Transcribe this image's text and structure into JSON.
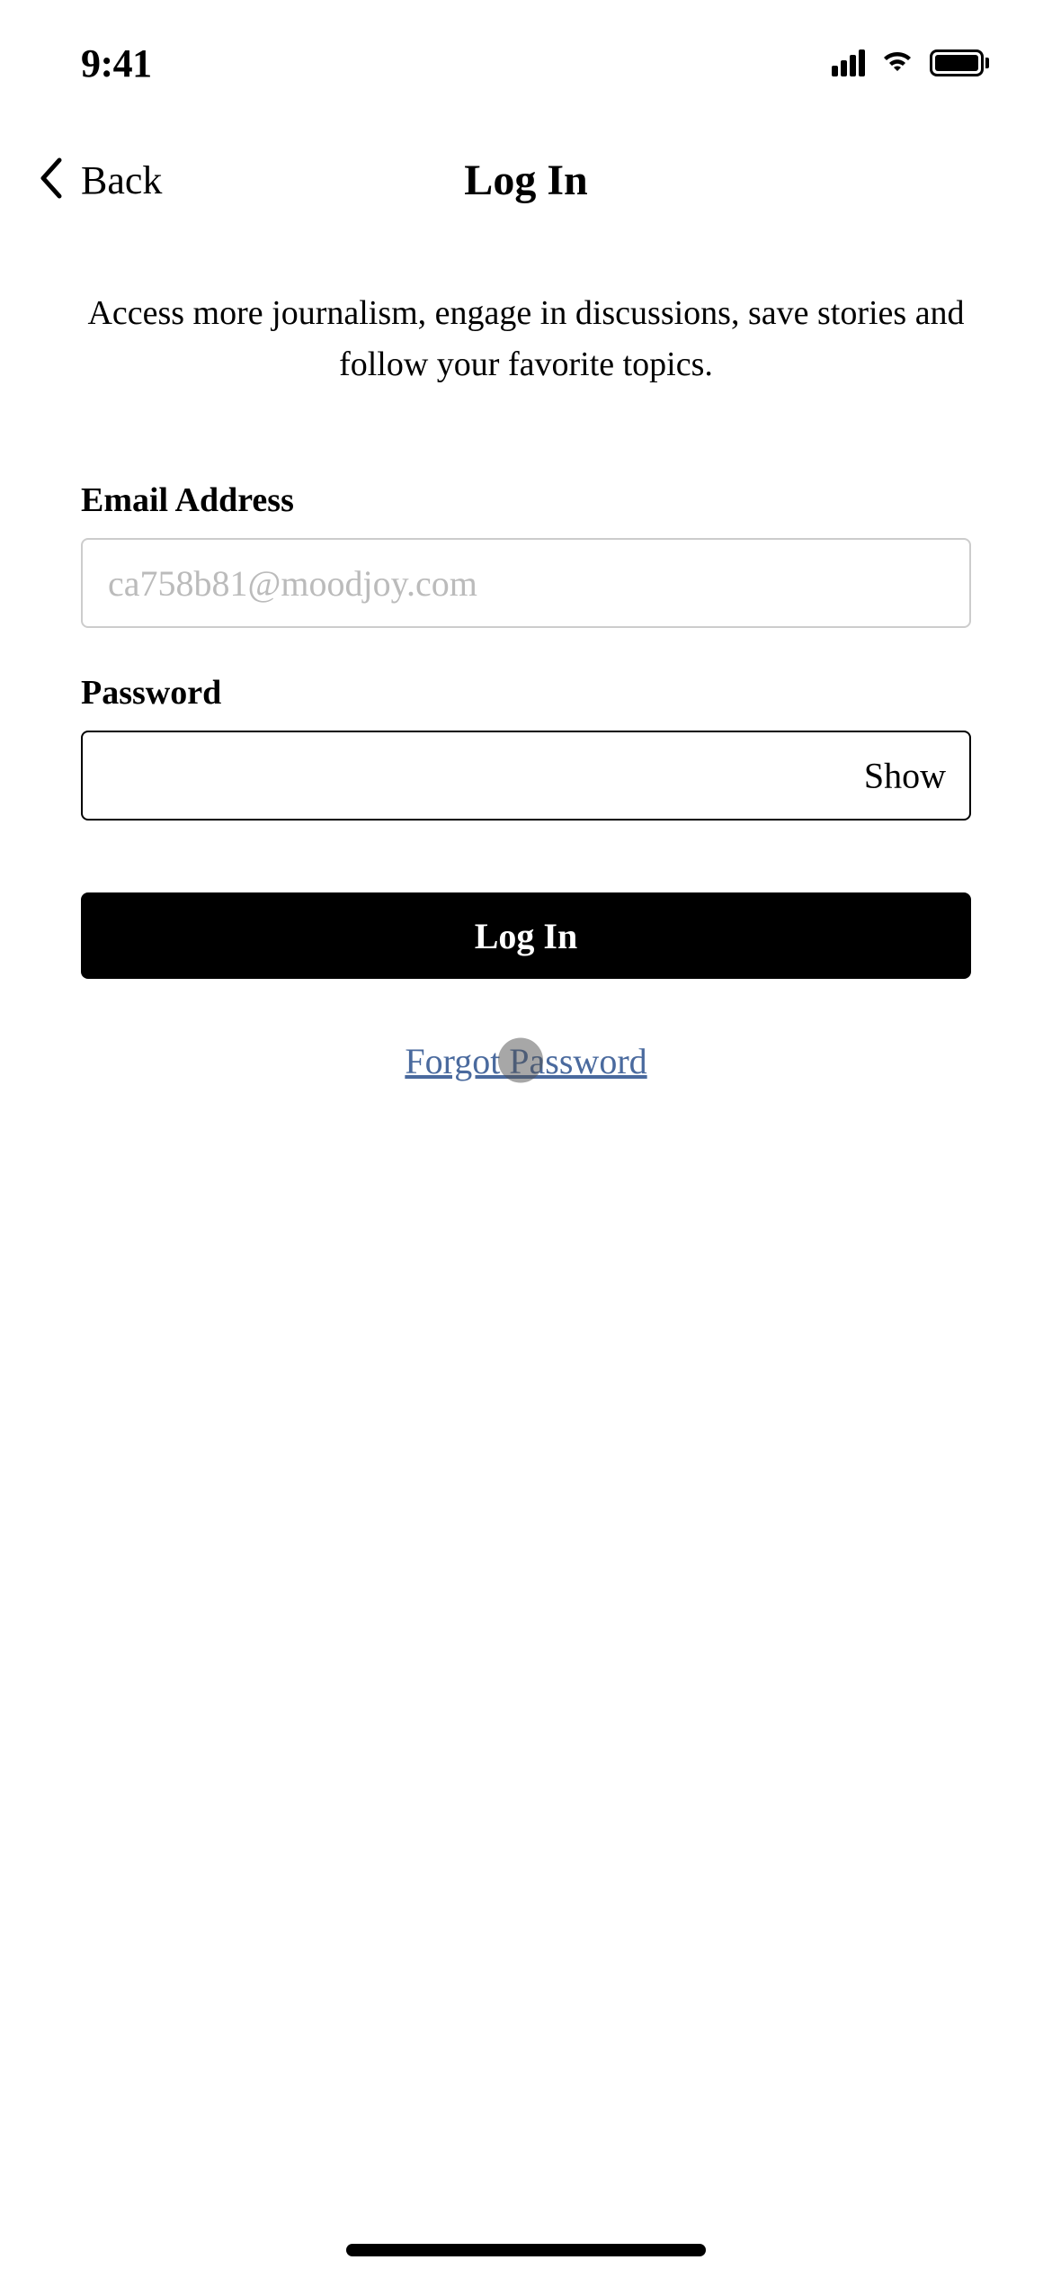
{
  "status": {
    "time": "9:41"
  },
  "nav": {
    "back_label": "Back",
    "title": "Log In"
  },
  "subtitle": "Access more journalism, engage in discussions, save stories and follow your favorite topics.",
  "form": {
    "email_label": "Email Address",
    "email_placeholder": "ca758b81@moodjoy.com",
    "email_value": "",
    "password_label": "Password",
    "password_value": "",
    "show_label": "Show",
    "login_button": "Log In",
    "forgot_link": "Forgot Password"
  }
}
